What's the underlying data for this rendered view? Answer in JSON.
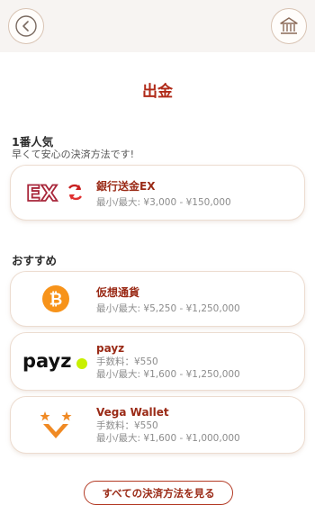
{
  "header": {
    "back_icon": "chevron-left-icon",
    "home_icon": "bank-building-icon"
  },
  "page": {
    "title": "出金"
  },
  "popular": {
    "heading": "1番人気",
    "subtitle": "早くて安心の決済方法です!",
    "methods": [
      {
        "name": "銀行送金EX",
        "logo_icon": "bank-transfer-ex-logo",
        "logo_text": "EX",
        "limit": "最小/最大: ¥3,000 - ¥150,000"
      }
    ]
  },
  "recommended": {
    "heading": "おすすめ",
    "methods": [
      {
        "name": "仮想通貨",
        "logo_icon": "bitcoin-icon",
        "logo_text": "₿",
        "limit": "最小/最大: ¥5,250 - ¥1,250,000"
      },
      {
        "name": "payz",
        "logo_icon": "payz-logo",
        "logo_text": "payz",
        "fee": "手数料：¥550",
        "limit": "最小/最大: ¥1,600 - ¥1,250,000"
      },
      {
        "name": "Vega Wallet",
        "logo_icon": "vega-wallet-logo",
        "fee": "手数料：¥550",
        "limit": "最小/最大: ¥1,600 - ¥1,000,000"
      }
    ]
  },
  "footer": {
    "all_methods_label": "すべての決済方法を見る"
  },
  "colors": {
    "accent": "#b02a18",
    "card_border": "#ecdcd0",
    "bitcoin": "#f7931a",
    "payz_dot": "#c8f000",
    "vega_orange": "#f08a24"
  }
}
